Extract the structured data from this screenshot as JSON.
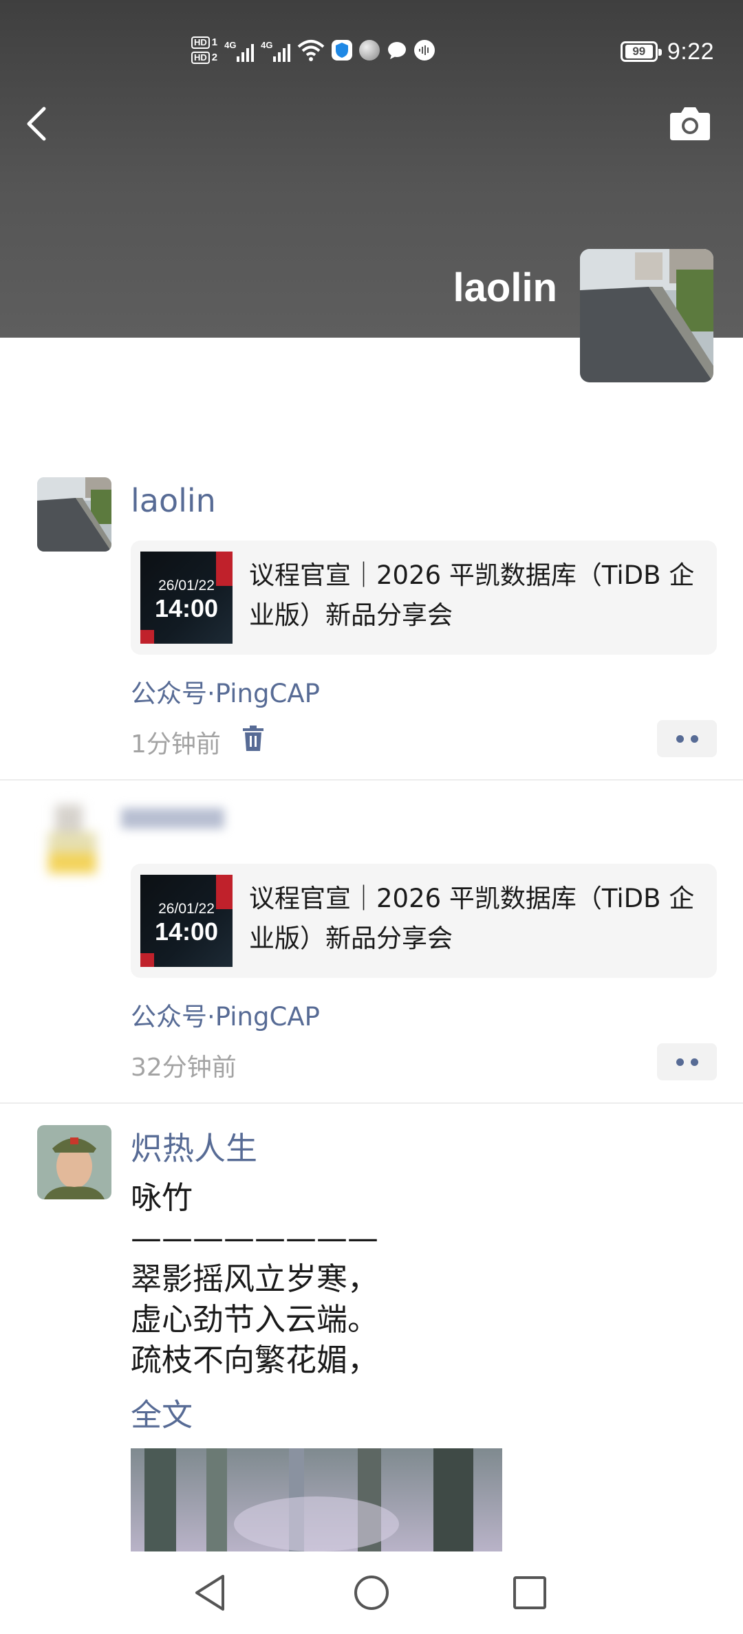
{
  "status_bar": {
    "hd1": "HD",
    "hd1_sub": "1",
    "hd2": "HD",
    "hd2_sub": "2",
    "net1": "4G",
    "net2": "4G",
    "battery": "99",
    "time": "9:22"
  },
  "header": {
    "back_icon": "chevron-left-icon",
    "camera_icon": "camera-icon",
    "profile_name": "laolin"
  },
  "posts": [
    {
      "author": "laolin",
      "share_card": {
        "thumb_date": "26/01/22",
        "thumb_time": "14:00",
        "title": "议程官宣｜2026 平凯数据库（TiDB 企业版）新品分享会"
      },
      "source": "公众号·PingCAP",
      "time_ago": "1分钟前"
    },
    {
      "author": "",
      "share_card": {
        "thumb_date": "26/01/22",
        "thumb_time": "14:00",
        "title": "议程官宣｜2026 平凯数据库（TiDB 企业版）新品分享会"
      },
      "source": "公众号·PingCAP",
      "time_ago": "32分钟前"
    },
    {
      "author": "炽热人生",
      "text_lines": [
        "咏竹",
        "————————",
        "翠影摇风立岁寒，",
        "虚心劲节入云端。",
        "疏枝不向繁花媚，"
      ],
      "full_text_link": "全文"
    }
  ],
  "colors": {
    "link": "#576b95",
    "timestamp": "#a3a3a3",
    "card_bg": "#f5f5f5"
  }
}
